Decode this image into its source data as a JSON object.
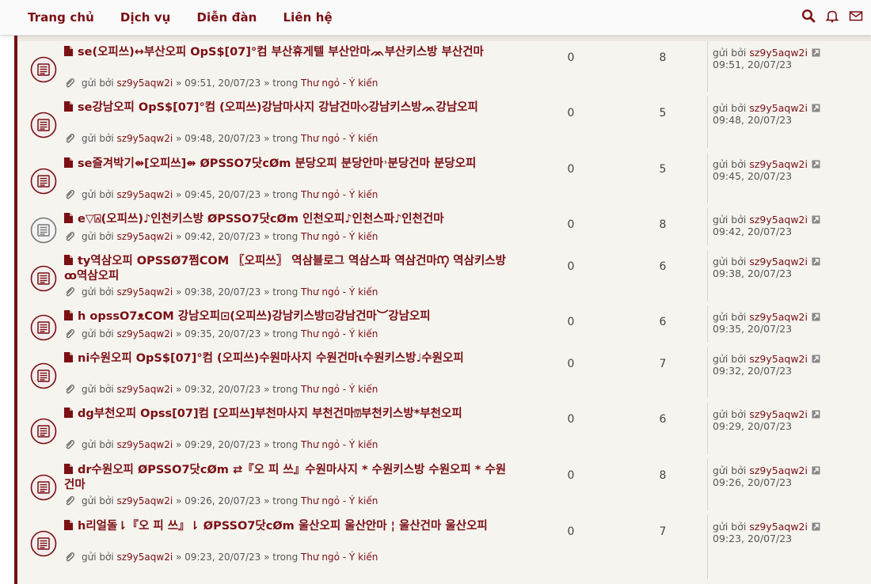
{
  "nav": {
    "items": [
      "Trang chủ",
      "Dịch vụ",
      "Diễn đàn",
      "Liên hệ"
    ],
    "icons": [
      "search-icon",
      "bell-icon",
      "envelope-icon"
    ]
  },
  "colors": {
    "accent": "#7a0f14",
    "panel": "#f6f4ef"
  },
  "topics": [
    {
      "title": "se(오피쓰)↔부산오피 OpS$[07]°컴 부산휴게텔 부산안마ᨏ부산키스방 부산건마",
      "by_label": "gửi bởi",
      "author": "sz9y5aqw2i",
      "time": "» 09:51, 20/07/23 »",
      "in_label": "trong",
      "forum": "Thư ngỏ - Ý kiến",
      "replies": "0",
      "views": "8",
      "last_by_label": "gửi bởi",
      "last_author": "sz9y5aqw2i",
      "last_time": "09:51, 20/07/23",
      "icon": "unread-topic-icon"
    },
    {
      "title": "se강남오피 OpS$[07]°컴 (오피쓰)강남마사지 강남건마⬦강남키스방ᨏ강남오피",
      "by_label": "gửi bởi",
      "author": "sz9y5aqw2i",
      "time": "» 09:48, 20/07/23 »",
      "in_label": "trong",
      "forum": "Thư ngỏ - Ý kiến",
      "replies": "0",
      "views": "5",
      "last_by_label": "gửi bởi",
      "last_author": "sz9y5aqw2i",
      "last_time": "09:48, 20/07/23",
      "icon": "unread-topic-icon"
    },
    {
      "title": "se즐겨박기⇴[오피쓰]⇴ ØPSSO7닷cØm 분당오피 분당안마˒분당건마 분당오피",
      "by_label": "gửi bởi",
      "author": "sz9y5aqw2i",
      "time": "» 09:45, 20/07/23 »",
      "in_label": "trong",
      "forum": "Thư ngỏ - Ý kiến",
      "replies": "0",
      "views": "5",
      "last_by_label": "gửi bởi",
      "last_author": "sz9y5aqw2i",
      "last_time": "09:45, 20/07/23",
      "icon": "unread-topic-icon"
    },
    {
      "title": "e▽⍓(오피쓰)♪인천키스방 ØPSSO7닷cØm 인천오피♪인천스파♪인천건마",
      "by_label": "gửi bởi",
      "author": "sz9y5aqw2i",
      "time": "» 09:42, 20/07/23 »",
      "in_label": "trong",
      "forum": "Thư ngỏ - Ý kiến",
      "replies": "0",
      "views": "8",
      "last_by_label": "gửi bởi",
      "last_author": "sz9y5aqw2i",
      "last_time": "09:42, 20/07/23",
      "icon": "read-topic-icon"
    },
    {
      "title": "ty역삼오피 OPSSØ7쩜COM 〖오피쓰〗 역삼블로그 역삼스파 역삼건마ᡗᡗ 역삼키스방ꝏ역삼오피",
      "by_label": "gửi bởi",
      "author": "sz9y5aqw2i",
      "time": "» 09:38, 20/07/23 »",
      "in_label": "trong",
      "forum": "Thư ngỏ - Ý kiến",
      "replies": "0",
      "views": "6",
      "last_by_label": "gửi bởi",
      "last_author": "sz9y5aqw2i",
      "last_time": "09:38, 20/07/23",
      "icon": "unread-topic-icon"
    },
    {
      "title": "h opssO7ᴥCOM 강남오피⊡(오피쓰)강남키스방⊡강남건마︶강남오피",
      "by_label": "gửi bởi",
      "author": "sz9y5aqw2i",
      "time": "» 09:35, 20/07/23 »",
      "in_label": "trong",
      "forum": "Thư ngỏ - Ý kiến",
      "replies": "0",
      "views": "6",
      "last_by_label": "gửi bởi",
      "last_author": "sz9y5aqw2i",
      "last_time": "09:35, 20/07/23",
      "icon": "unread-topic-icon"
    },
    {
      "title": "ni수원오피 OpS$[07]°컴 (오피쓰)수원마사지 수원건마ɩ수원키스방♩수원오피",
      "by_label": "gửi bởi",
      "author": "sz9y5aqw2i",
      "time": "» 09:32, 20/07/23 »",
      "in_label": "trong",
      "forum": "Thư ngỏ - Ý kiến",
      "replies": "0",
      "views": "7",
      "last_by_label": "gửi bởi",
      "last_author": "sz9y5aqw2i",
      "last_time": "09:32, 20/07/23",
      "icon": "unread-topic-icon"
    },
    {
      "title": "dg부천오피 Opss[07]컴 [오피쓰]부천마사지 부천건마⍔부천키스방*부천오피",
      "by_label": "gửi bởi",
      "author": "sz9y5aqw2i",
      "time": "» 09:29, 20/07/23 »",
      "in_label": "trong",
      "forum": "Thư ngỏ - Ý kiến",
      "replies": "0",
      "views": "6",
      "last_by_label": "gửi bởi",
      "last_author": "sz9y5aqw2i",
      "last_time": "09:29, 20/07/23",
      "icon": "unread-topic-icon"
    },
    {
      "title": "dr수원오피 ØPSSO7닷cØm ⇄『오 피 쓰』수원마사지 * 수원키스방 수원오피 * 수원건마",
      "by_label": "gửi bởi",
      "author": "sz9y5aqw2i",
      "time": "» 09:26, 20/07/23 »",
      "in_label": "trong",
      "forum": "Thư ngỏ - Ý kiến",
      "replies": "0",
      "views": "8",
      "last_by_label": "gửi bởi",
      "last_author": "sz9y5aqw2i",
      "last_time": "09:26, 20/07/23",
      "icon": "unread-topic-icon"
    },
    {
      "title": "h리얼돌⇂『오 피 쓰』⇂ ØPSSO7닷cØm 울산오피 울산안마 ¦ 울산건마 울산오피",
      "by_label": "gửi bởi",
      "author": "sz9y5aqw2i",
      "time": "» 09:23, 20/07/23 »",
      "in_label": "trong",
      "forum": "Thư ngỏ - Ý kiến",
      "replies": "0",
      "views": "7",
      "last_by_label": "gửi bởi",
      "last_author": "sz9y5aqw2i",
      "last_time": "09:23, 20/07/23",
      "icon": "unread-topic-icon"
    }
  ]
}
